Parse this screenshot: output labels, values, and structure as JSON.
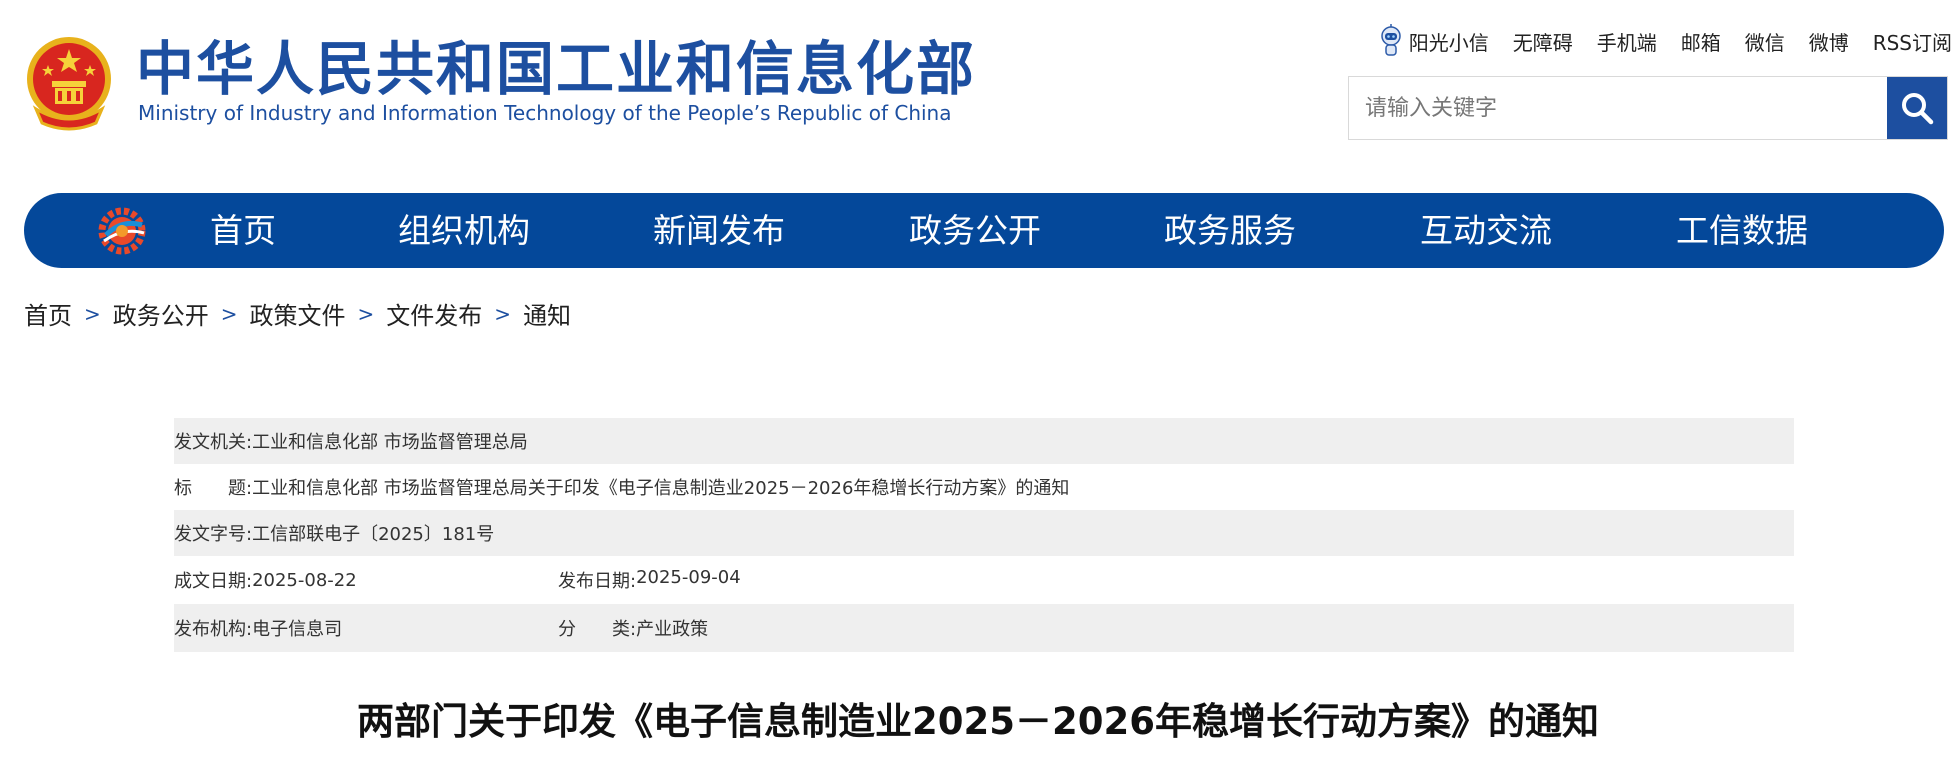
{
  "header": {
    "brand_cn": "中华人民共和国工业和信息化部",
    "brand_en": "Ministry of Industry and Information Technology of the People’s Republic of China",
    "top_links": [
      "阳光小信",
      "无障碍",
      "手机端",
      "邮箱",
      "微信",
      "微博",
      "RSS订阅"
    ],
    "search_placeholder": "请输入关键字",
    "search_icon": "magnifier-icon"
  },
  "nav": {
    "items": [
      "首页",
      "组织机构",
      "新闻发布",
      "政务公开",
      "政务服务",
      "互动交流",
      "工信数据"
    ]
  },
  "breadcrumb": [
    "首页",
    "政务公开",
    "政策文件",
    "文件发布",
    "通知"
  ],
  "breadcrumb_separator": ">",
  "info": {
    "issuer_label": "发文机关:",
    "issuer": "工业和信息化部 市场监督管理总局",
    "title_label": "标　　题:",
    "title": "工业和信息化部 市场监督管理总局关于印发《电子信息制造业2025－2026年稳增长行动方案》的通知",
    "doc_no_label": "发文字号:",
    "doc_no": "工信部联电子〔2025〕181号",
    "written_date_label": "成文日期:",
    "written_date": "2025-08-22",
    "publish_date_label": "发布日期:",
    "publish_date": "2025-09-04",
    "agency_label": "发布机构:",
    "agency": "电子信息司",
    "category_label": "分　　类:",
    "category": "产业政策"
  },
  "document": {
    "title": "两部门关于印发《电子信息制造业2025－2026年稳增长行动方案》的通知"
  },
  "colors": {
    "brand_blue": "#1d4fa0",
    "nav_blue": "#04489a",
    "row_shade": "#efefef"
  }
}
